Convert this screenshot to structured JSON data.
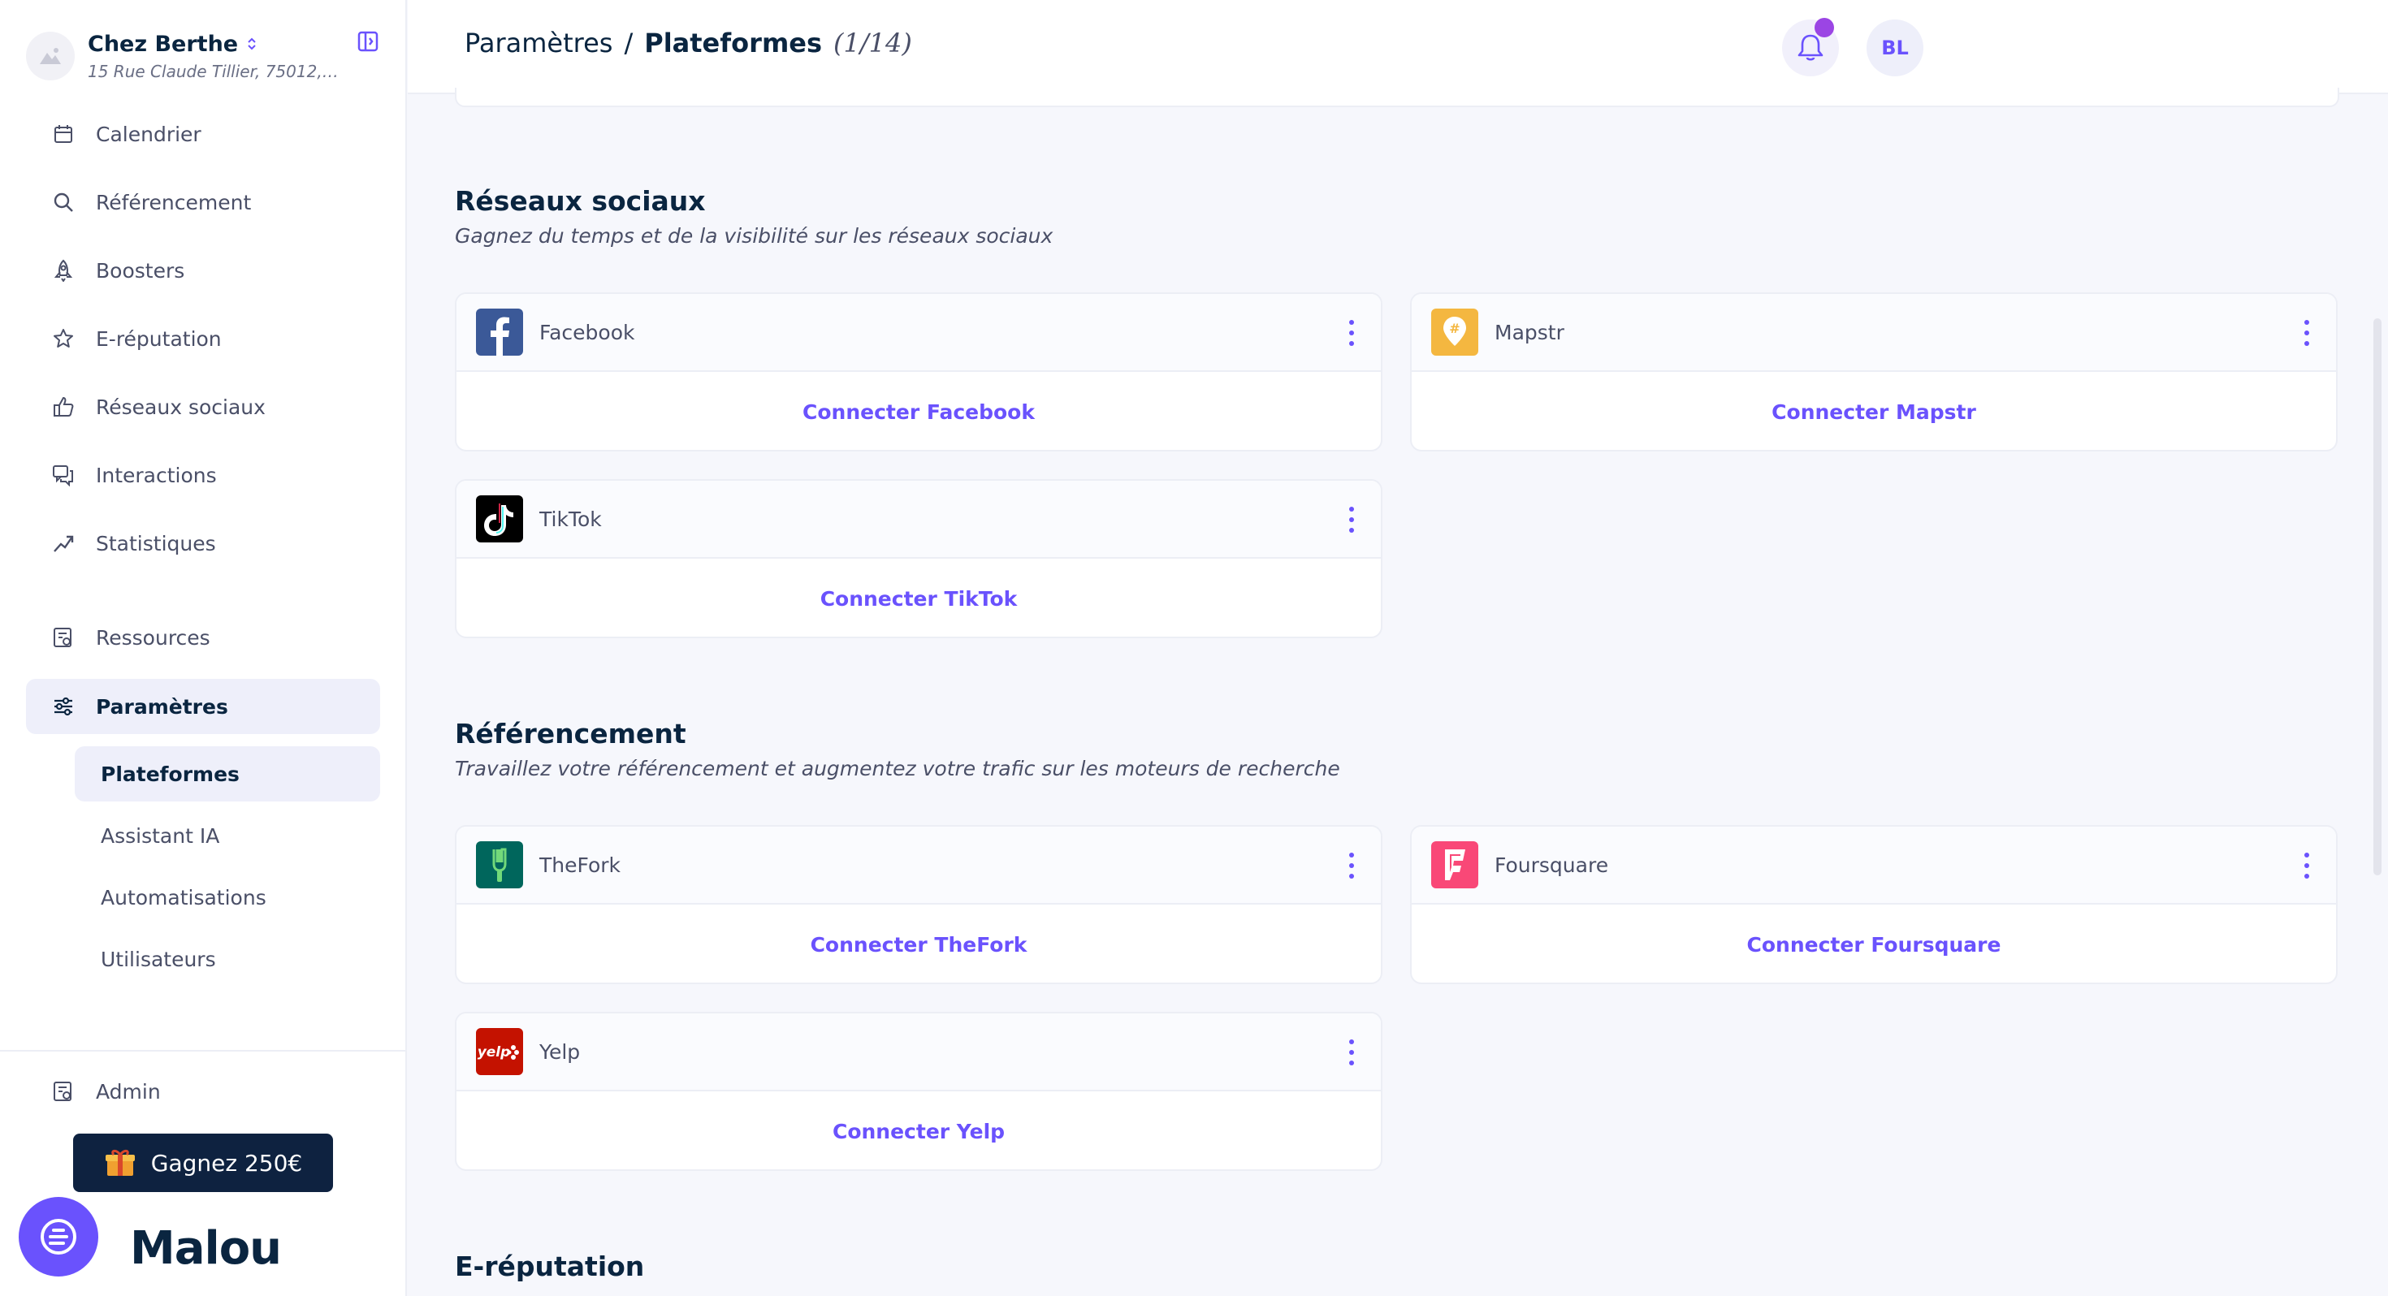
{
  "restaurant": {
    "name": "Chez Berthe",
    "address": "15 Rue Claude Tillier, 75012, Par..."
  },
  "sidebar": {
    "items": [
      {
        "label": "Calendrier",
        "icon": "calendar-icon"
      },
      {
        "label": "Référencement",
        "icon": "search-icon"
      },
      {
        "label": "Boosters",
        "icon": "rocket-icon"
      },
      {
        "label": "E-réputation",
        "icon": "star-icon"
      },
      {
        "label": "Réseaux sociaux",
        "icon": "thumbs-up-icon"
      },
      {
        "label": "Interactions",
        "icon": "chat-icon"
      },
      {
        "label": "Statistiques",
        "icon": "trend-up-icon"
      }
    ],
    "resources": "Ressources",
    "settings": "Paramètres",
    "sub_items": [
      "Plateformes",
      "Assistant IA",
      "Automatisations",
      "Utilisateurs"
    ],
    "admin": "Admin",
    "gift_button": "Gagnez 250€",
    "logo": "Malou"
  },
  "header": {
    "crumb_parent": "Paramètres",
    "separator": "/",
    "crumb_current": "Plateformes",
    "count": "(1/14)",
    "avatar_initials": "BL"
  },
  "sections": {
    "social": {
      "title": "Réseaux sociaux",
      "subtitle": "Gagnez du temps et de la visibilité sur les réseaux sociaux",
      "cards": [
        {
          "name": "Facebook",
          "action": "Connecter Facebook"
        },
        {
          "name": "Mapstr",
          "action": "Connecter Mapstr"
        },
        {
          "name": "TikTok",
          "action": "Connecter TikTok"
        }
      ]
    },
    "seo": {
      "title": "Référencement",
      "subtitle": "Travaillez votre référencement et augmentez votre trafic sur les moteurs de recherche",
      "cards": [
        {
          "name": "TheFork",
          "action": "Connecter TheFork"
        },
        {
          "name": "Foursquare",
          "action": "Connecter Foursquare"
        },
        {
          "name": "Yelp",
          "action": "Connecter Yelp"
        }
      ]
    },
    "reputation": {
      "title": "E-réputation"
    }
  },
  "colors": {
    "accent": "#6a52fd",
    "navy": "#0a2540",
    "facebook": "#3b5998",
    "mapstr": "#f4b740",
    "tiktok": "#000000",
    "thefork": "#00665c",
    "foursquare": "#f94877",
    "yelp": "#c41200"
  }
}
